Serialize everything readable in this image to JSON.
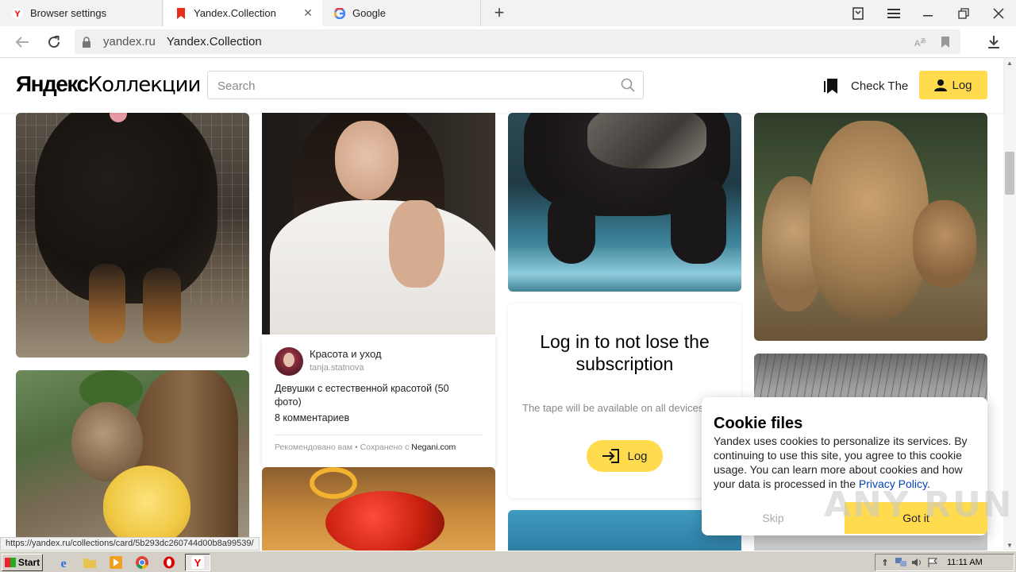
{
  "browser": {
    "tabs": [
      {
        "label": "Browser settings",
        "icon": "yandex-y-icon"
      },
      {
        "label": "Yandex.Collection",
        "icon": "collections-bookmark-icon"
      },
      {
        "label": "Google",
        "icon": "google-g-icon"
      }
    ],
    "address": {
      "host": "yandex.ru",
      "page_title": "Yandex.Collection"
    }
  },
  "header": {
    "logo_part1": "Яндекс",
    "logo_part2": "Коллекции",
    "search_placeholder": "Search",
    "check_label": "Check The",
    "login_label": "Log"
  },
  "post": {
    "collection_title": "Красота и уход",
    "author": "tanja.statnova",
    "description": "Девушки с естественной красотой (50 фото)",
    "comments": "8 комментариев",
    "footer_prefix": "Рекомендовано вам  •  Сохранено с",
    "source": "Negani.com"
  },
  "login_card": {
    "title": "Log in to not lose the subscription",
    "subtitle": "The tape will be available on all devices where you login",
    "button": "Log"
  },
  "cookie": {
    "title": "Cookie files",
    "body": "Yandex uses cookies to personalize its services. By continuing to use this site, you agree to this cookie usage. You can learn more about cookies and how your data is processed in the",
    "link": "Privacy Policy",
    "skip": "Skip",
    "accept": "Got it"
  },
  "status_link": "https://yandex.ru/collections/card/5b293dc260744d00b8a99539/",
  "watermark": "ANY RUN",
  "taskbar": {
    "start": "Start",
    "clock": "11:11 AM"
  },
  "colors": {
    "accent_yellow": "#ffdb4d",
    "logo_red": "#ff0000",
    "link_blue": "#0044bb"
  }
}
